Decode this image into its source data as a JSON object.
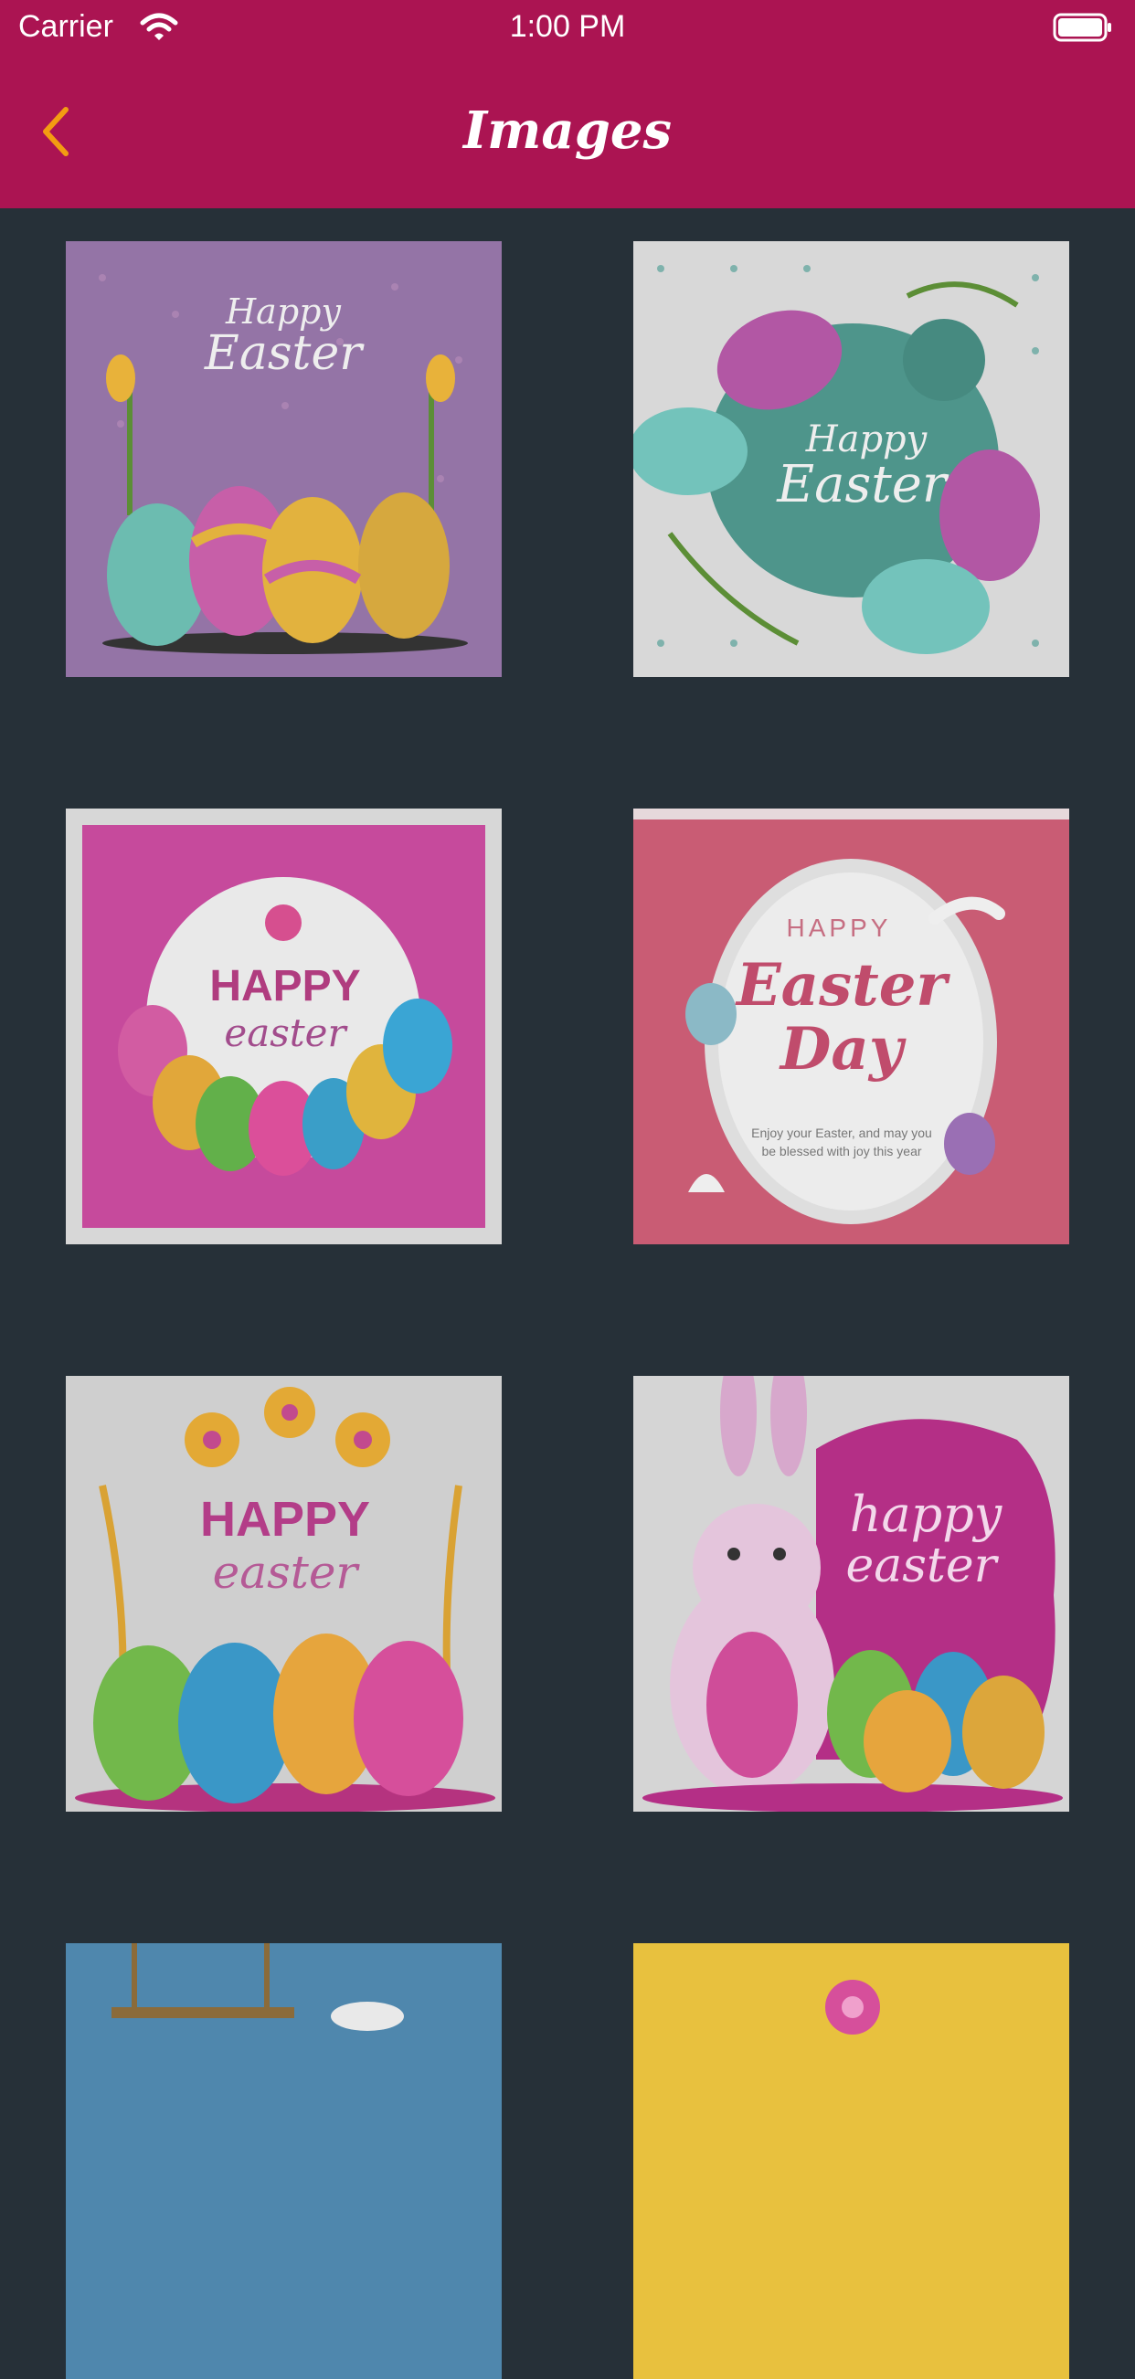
{
  "status_bar": {
    "carrier": "Carrier",
    "time": "1:00 PM"
  },
  "nav": {
    "title": "Images",
    "back_icon": "chevron-left-icon"
  },
  "colors": {
    "header": "#ab1452",
    "back_icon": "#f39c12",
    "background": "#263038"
  },
  "images": [
    {
      "name": "easter-card-1",
      "lines": [
        "Happy",
        "Easter"
      ]
    },
    {
      "name": "easter-card-2",
      "lines": [
        "Happy",
        "Easter"
      ]
    },
    {
      "name": "easter-card-3",
      "lines": [
        "HAPPY",
        "easter"
      ]
    },
    {
      "name": "easter-card-4",
      "lines": [
        "HAPPY",
        "Easter",
        "Day",
        "Enjoy your Easter, and may you",
        "be blessed with joy this year"
      ]
    },
    {
      "name": "easter-card-5",
      "lines": [
        "HAPPY",
        "easter"
      ]
    },
    {
      "name": "easter-card-6",
      "lines": [
        "happy",
        "easter"
      ]
    },
    {
      "name": "easter-card-7",
      "lines": []
    },
    {
      "name": "easter-card-8",
      "lines": []
    }
  ]
}
